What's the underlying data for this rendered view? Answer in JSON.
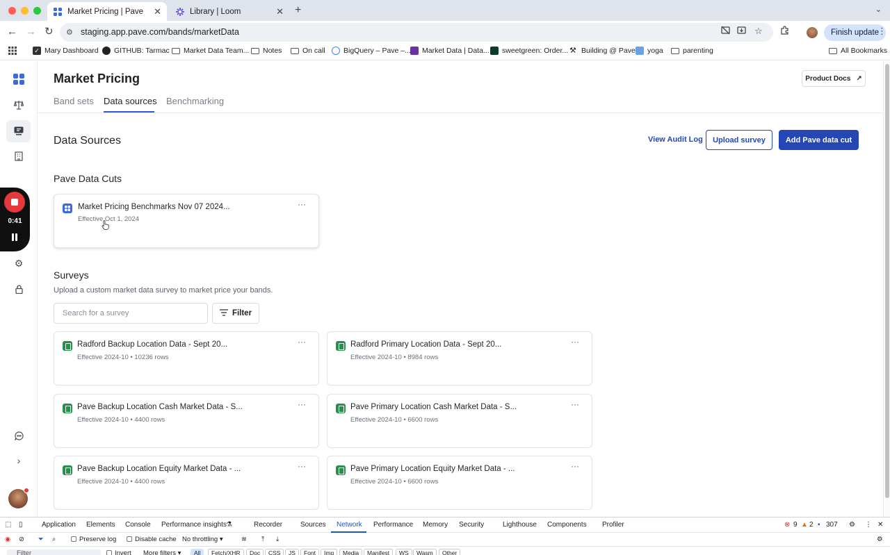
{
  "browser": {
    "tabs": [
      {
        "title": "Market Pricing | Pave",
        "active": true
      },
      {
        "title": "Library | Loom",
        "active": false
      }
    ],
    "url": "staging.app.pave.com/bands/marketData",
    "finish_update": "Finish update",
    "bookmarks": [
      "Mary Dashboard",
      "GITHUB: Tarmac",
      "Market Data Team...",
      "Notes",
      "On call",
      "BigQuery – Pave –...",
      "Market Data | Data...",
      "sweetgreen: Order...",
      "Building @ Pave",
      "yoga",
      "parenting"
    ],
    "all_bookmarks": "All Bookmarks"
  },
  "recorder": {
    "time": "0:41"
  },
  "header": {
    "title": "Market Pricing",
    "product_docs": "Product Docs",
    "tabs": [
      "Band sets",
      "Data sources",
      "Benchmarking"
    ],
    "active_tab": "Data sources"
  },
  "data_sources": {
    "title": "Data Sources",
    "view_audit_log": "View Audit Log",
    "upload_survey": "Upload survey",
    "add_cut": "Add Pave data cut"
  },
  "pave_cuts": {
    "title": "Pave Data Cuts",
    "items": [
      {
        "name": "Market Pricing Benchmarks Nov 07 2024...",
        "sub": "Effective Oct 1, 2024"
      }
    ]
  },
  "surveys": {
    "title": "Surveys",
    "description": "Upload a custom market data survey to market price your bands.",
    "search_placeholder": "Search for a survey",
    "filter": "Filter",
    "items": [
      {
        "name": "Radford Backup Location Data - Sept 20...",
        "sub": "Effective 2024-10 • 10236 rows"
      },
      {
        "name": "Radford Primary Location Data - Sept 20...",
        "sub": "Effective 2024-10 • 8984 rows"
      },
      {
        "name": "Pave Backup Location Cash Market Data - S...",
        "sub": "Effective 2024-10 • 4400 rows"
      },
      {
        "name": "Pave Primary Location Cash Market Data - S...",
        "sub": "Effective 2024-10 • 6600 rows"
      },
      {
        "name": "Pave Backup Location Equity Market Data - ...",
        "sub": "Effective 2024-10 • 4400 rows"
      },
      {
        "name": "Pave Primary Location Equity Market Data - ...",
        "sub": "Effective 2024-10 • 6600 rows"
      }
    ]
  },
  "devtools": {
    "tabs": [
      "Application",
      "Elements",
      "Console",
      "Performance insights",
      "Recorder",
      "Sources",
      "Network",
      "Performance",
      "Memory",
      "Security",
      "Lighthouse",
      "Components",
      "Profiler"
    ],
    "active_tab": "Network",
    "errors": "9",
    "warnings": "2",
    "messages": "307",
    "preserve_log": "Preserve log",
    "disable_cache": "Disable cache",
    "throttling": "No throttling",
    "filter_placeholder": "Filter",
    "invert": "Invert",
    "more_filters": "More filters",
    "type_filters": [
      "All",
      "Fetch/XHR",
      "Doc",
      "CSS",
      "JS",
      "Font",
      "Img",
      "Media",
      "Manifest",
      "WS",
      "Wasm",
      "Other"
    ]
  },
  "colors": {
    "accent": "#2447b5",
    "sheet_green": "#27904a",
    "pave_blue": "#3e68df",
    "record_red": "#e5383b"
  }
}
